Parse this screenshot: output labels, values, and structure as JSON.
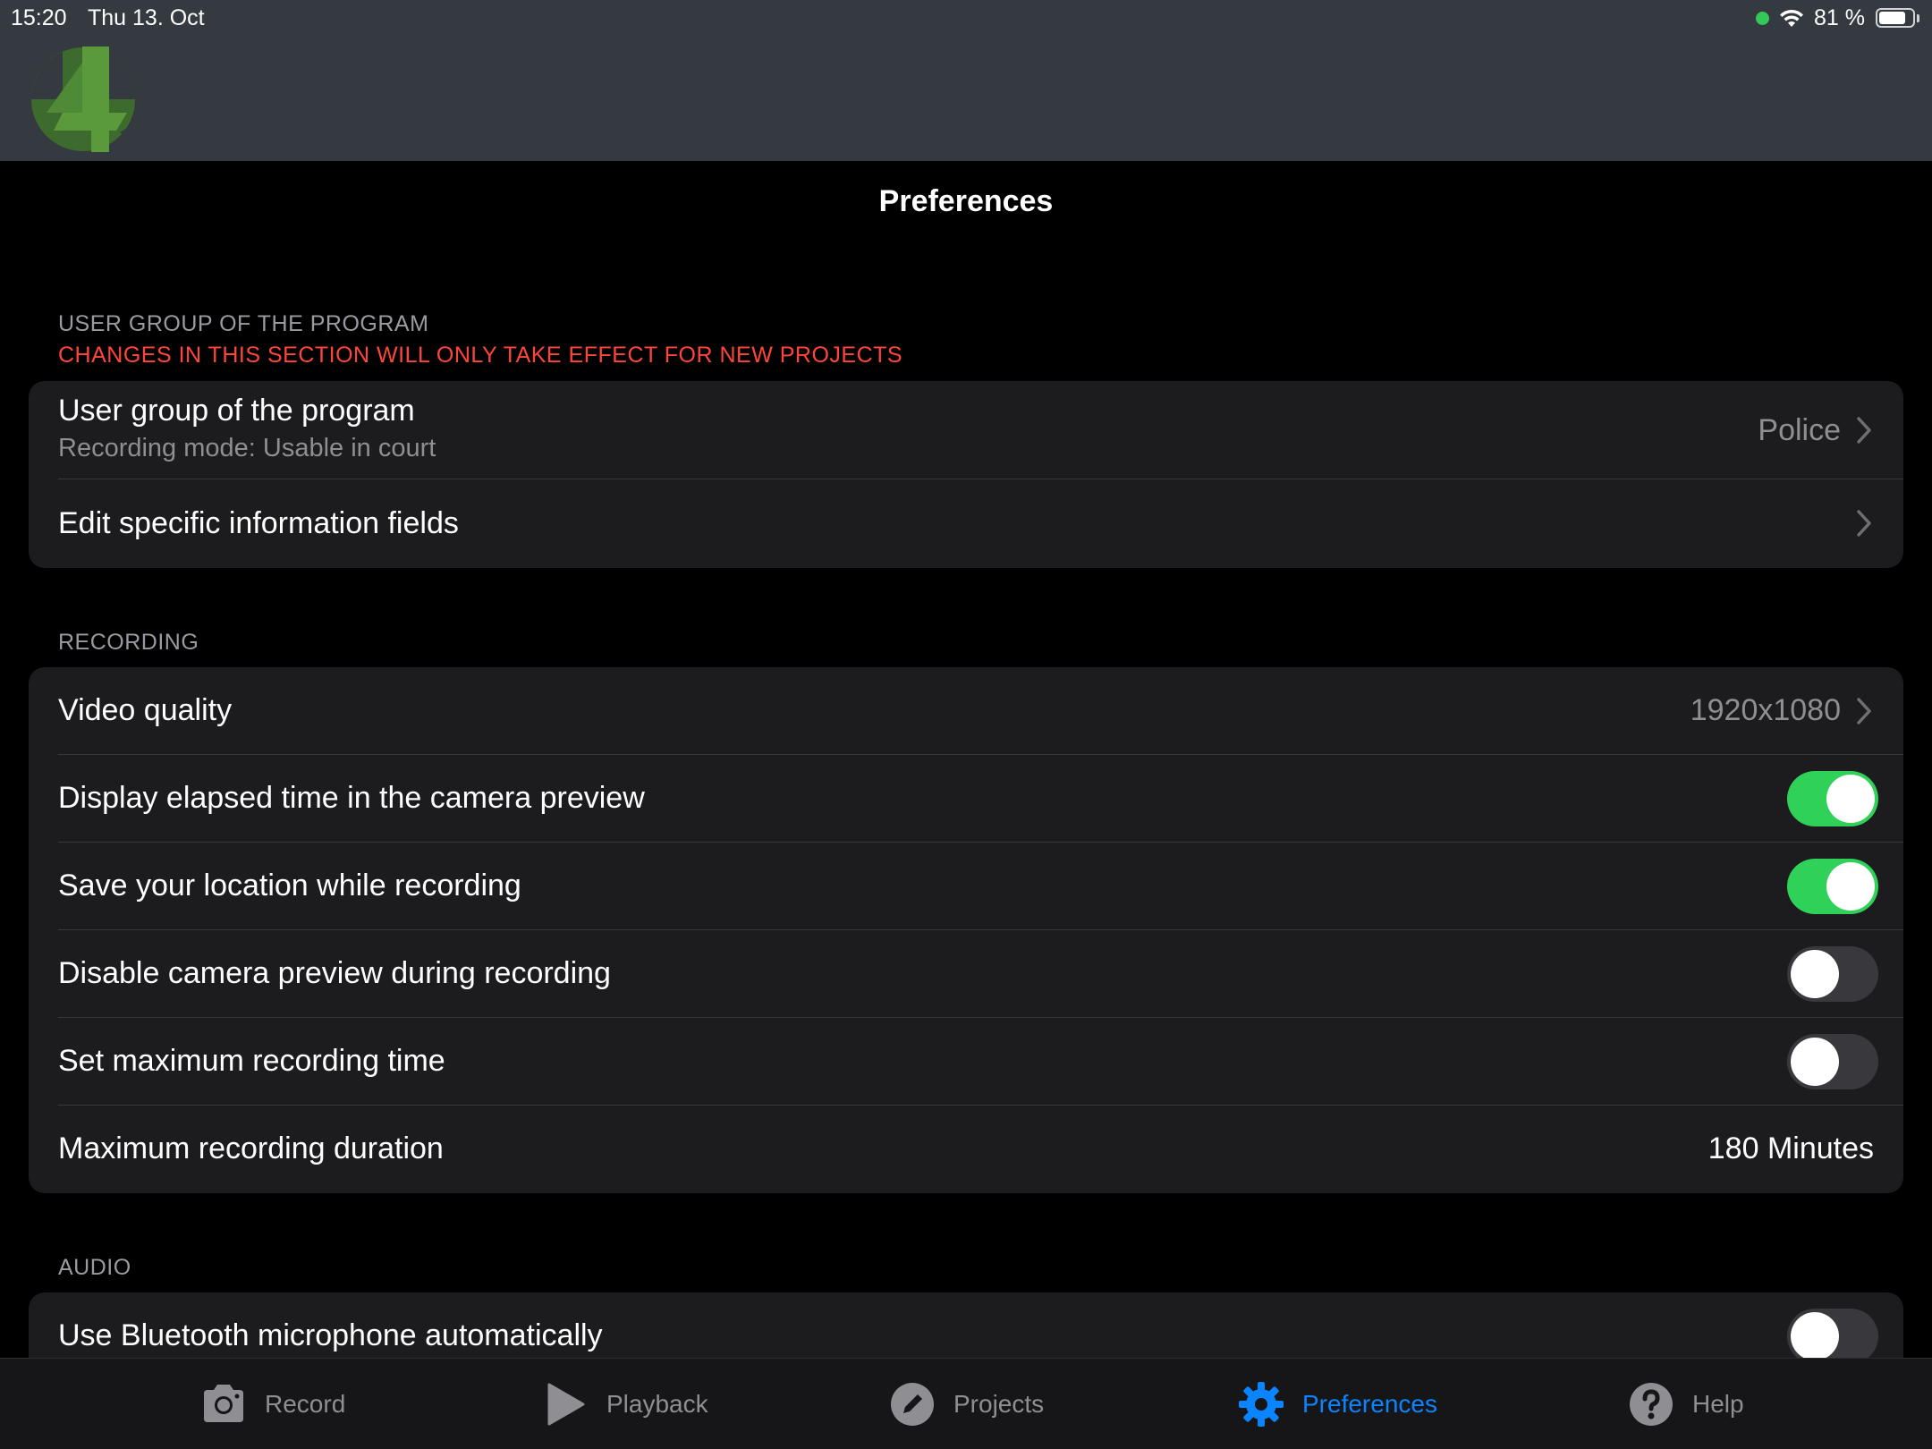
{
  "status_bar": {
    "time": "15:20",
    "date": "Thu 13. Oct",
    "battery_text": "81 %",
    "battery_level": 0.81
  },
  "page": {
    "title": "Preferences"
  },
  "sections": {
    "user_group": {
      "header": "USER GROUP OF THE PROGRAM",
      "warning": "CHANGES IN THIS SECTION WILL ONLY TAKE EFFECT FOR NEW PROJECTS",
      "rows": {
        "user_group": {
          "label": "User group of the program",
          "sublabel": "Recording mode: Usable in court",
          "value": "Police"
        },
        "edit_fields": {
          "label": "Edit specific information fields"
        }
      }
    },
    "recording": {
      "header": "RECORDING",
      "rows": {
        "video_quality": {
          "label": "Video quality",
          "value": "1920x1080"
        },
        "elapsed_time": {
          "label": "Display elapsed time in the camera preview",
          "on": true
        },
        "save_location": {
          "label": "Save your location while recording",
          "on": true
        },
        "disable_preview": {
          "label": "Disable camera preview during recording",
          "on": false
        },
        "max_time": {
          "label": "Set maximum recording time",
          "on": false
        },
        "max_duration": {
          "label": "Maximum recording duration",
          "value": "180 Minutes"
        }
      }
    },
    "audio": {
      "header": "AUDIO",
      "rows": {
        "bluetooth_mic": {
          "label": "Use Bluetooth microphone automatically",
          "on": false
        }
      }
    }
  },
  "tabbar": {
    "tabs": [
      {
        "label": "Record",
        "icon": "camera-icon",
        "active": false
      },
      {
        "label": "Playback",
        "icon": "play-icon",
        "active": false
      },
      {
        "label": "Projects",
        "icon": "pencil-icon",
        "active": false
      },
      {
        "label": "Preferences",
        "icon": "gear-icon",
        "active": true
      },
      {
        "label": "Help",
        "icon": "question-icon",
        "active": false
      }
    ]
  },
  "colors": {
    "accent": "#0a84ff",
    "toggle_on": "#30d158",
    "warning": "#ff453a",
    "header_bg": "#353a40",
    "card_bg": "#1c1c1e"
  }
}
